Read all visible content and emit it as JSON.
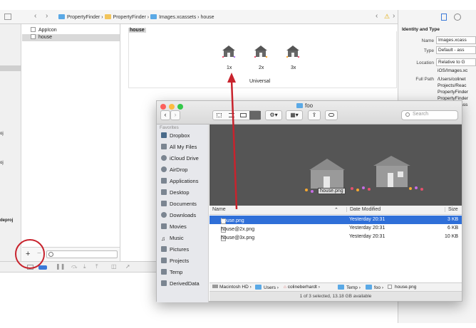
{
  "xcode": {
    "breadcrumb": [
      "PropertyFinder",
      "PropertyFinder",
      "Images.xcassets",
      "house"
    ],
    "file_list": [
      {
        "label": "AppIcon",
        "selected": false
      },
      {
        "label": "house",
        "selected": true
      }
    ],
    "left_edge_labels": [
      "oj",
      "oj",
      "deproj"
    ],
    "asset_title": "house",
    "scale_labels": [
      "1x",
      "2x",
      "3x"
    ],
    "universal_label": "Universal",
    "inspector": {
      "section_title": "Identity and Type",
      "name_label": "Name",
      "name_value": "Images.xcass",
      "type_label": "Type",
      "type_value": "Default - ass",
      "location_label": "Location",
      "location_value": "Relative to G",
      "location_sub": "iOS/Images.xc",
      "fullpath_label": "Full Path",
      "fullpath_lines": [
        "/Users/colinet",
        "Projects/Reac",
        "PropertyFinder",
        "PropertyFinder",
        "cass"
      ]
    },
    "add_button": "+",
    "remove_button": "−"
  },
  "finder": {
    "title": "foo",
    "search_placeholder": "Search",
    "sidebar": {
      "section": "Favorites",
      "items": [
        {
          "label": "Dropbox",
          "icon": "dropbox-icon"
        },
        {
          "label": "All My Files",
          "icon": "all-files-icon"
        },
        {
          "label": "iCloud Drive",
          "icon": "cloud-icon"
        },
        {
          "label": "AirDrop",
          "icon": "airdrop-icon"
        },
        {
          "label": "Applications",
          "icon": "applications-icon"
        },
        {
          "label": "Desktop",
          "icon": "desktop-icon"
        },
        {
          "label": "Documents",
          "icon": "documents-icon"
        },
        {
          "label": "Downloads",
          "icon": "downloads-icon"
        },
        {
          "label": "Movies",
          "icon": "movies-icon"
        },
        {
          "label": "Music",
          "icon": "music-icon"
        },
        {
          "label": "Pictures",
          "icon": "pictures-icon"
        },
        {
          "label": "Projects",
          "icon": "folder-icon"
        },
        {
          "label": "Temp",
          "icon": "folder-icon"
        },
        {
          "label": "DerivedData",
          "icon": "folder-icon"
        }
      ]
    },
    "preview_label": "house.png",
    "columns": {
      "name": "Name",
      "date": "Date Modified",
      "size": "Size"
    },
    "files": [
      {
        "name": "house.png",
        "date": "Yesterday 20:31",
        "size": "3 KB",
        "selected": true
      },
      {
        "name": "house@2x.png",
        "date": "Yesterday 20:31",
        "size": "6 KB",
        "selected": false
      },
      {
        "name": "house@3x.png",
        "date": "Yesterday 20:31",
        "size": "10 KB",
        "selected": false
      }
    ],
    "path": [
      "Macintosh HD",
      "Users",
      "colineberhardt",
      "Temp",
      "foo",
      "house.png"
    ],
    "status": "1 of 3 selected, 13.18 GB available"
  },
  "colors": {
    "selection": "#2f6fd8",
    "annotation": "#c8232d",
    "preview_bg": "#555555"
  }
}
